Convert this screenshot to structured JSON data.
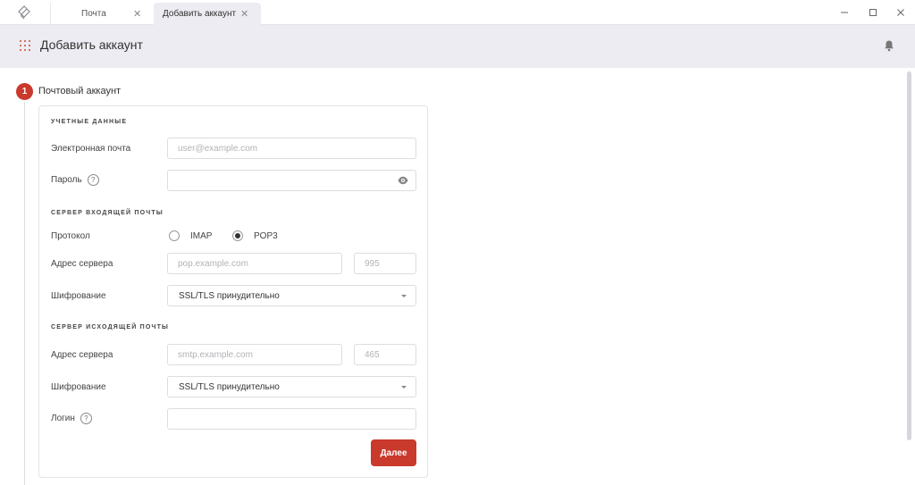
{
  "tabs": [
    {
      "label": "Почта"
    },
    {
      "label": "Добавить аккаунт"
    }
  ],
  "header": {
    "title": "Добавить аккаунт"
  },
  "step": {
    "number": "1",
    "title": "Почтовый аккаунт"
  },
  "credentials": {
    "heading": "УЧЕТНЫЕ ДАННЫЕ",
    "email_label": "Электронная почта",
    "email_placeholder": "user@example.com",
    "email_value": "",
    "password_label": "Пароль",
    "password_value": ""
  },
  "incoming": {
    "heading": "СЕРВЕР ВХОДЯЩЕЙ ПОЧТЫ",
    "protocol_label": "Протокол",
    "protocol_options": [
      "IMAP",
      "POP3"
    ],
    "protocol_selected": "POP3",
    "server_label": "Адрес сервера",
    "server_placeholder": "pop.example.com",
    "port_placeholder": "995",
    "encryption_label": "Шифрование",
    "encryption_value": "SSL/TLS принудительно"
  },
  "outgoing": {
    "heading": "СЕРВЕР ИСХОДЯЩЕЙ ПОЧТЫ",
    "server_label": "Адрес сервера",
    "server_placeholder": "smtp.example.com",
    "port_placeholder": "465",
    "encryption_label": "Шифрование",
    "encryption_value": "SSL/TLS принудительно",
    "login_label": "Логин",
    "login_value": ""
  },
  "help_glyph": "?",
  "next_label": "Далее",
  "colors": {
    "accent": "#c9392c",
    "header_bg": "#ececf2",
    "border": "#dcdce2"
  }
}
